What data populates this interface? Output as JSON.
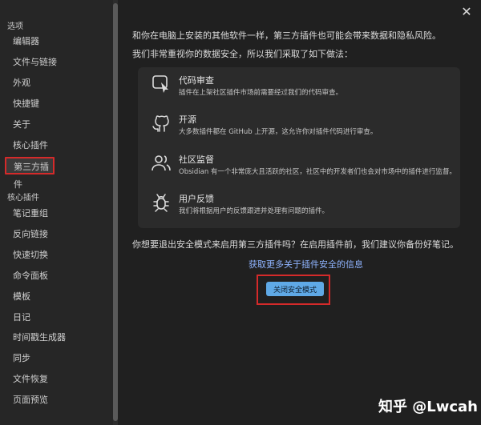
{
  "sidebar": {
    "options_header": "选项",
    "options_items": [
      "编辑器",
      "文件与链接",
      "外观",
      "快捷键",
      "关于",
      "核心插件",
      "第三方插件"
    ],
    "core_header": "核心插件",
    "core_items": [
      "笔记重组",
      "反向链接",
      "快速切换",
      "命令面板",
      "模板",
      "日记",
      "时间戳生成器",
      "同步",
      "文件恢复",
      "页面预览"
    ],
    "active_item": "第三方插件"
  },
  "main": {
    "intro_line1": "和你在电脑上安装的其他软件一样，第三方插件也可能会带来数据和隐私风险。",
    "intro_line2": "我们非常重视你的数据安全，所以我们采取了如下做法：",
    "features": [
      {
        "icon": "code-review-icon",
        "title": "代码审查",
        "desc": "插件在上架社区插件市场前需要经过我们的代码审查。"
      },
      {
        "icon": "github-icon",
        "title": "开源",
        "desc": "大多数插件都在 GitHub 上开源，这允许你对插件代码进行审查。"
      },
      {
        "icon": "users-icon",
        "title": "社区监督",
        "desc": "Obsidian 有一个非常庞大且活跃的社区，社区中的开发者们也会对市场中的插件进行监督。"
      },
      {
        "icon": "bug-icon",
        "title": "用户反馈",
        "desc": "我们将根据用户的反馈跟进并处理有问题的插件。"
      }
    ],
    "question": "你想要退出安全模式来启用第三方插件吗？在启用插件前，我们建议你备份好笔记。",
    "learn_more_link": "获取更多关于插件安全的信息",
    "button_label": "关闭安全模式",
    "close_glyph": "✕"
  },
  "watermark": "知乎 @Lwcah"
}
